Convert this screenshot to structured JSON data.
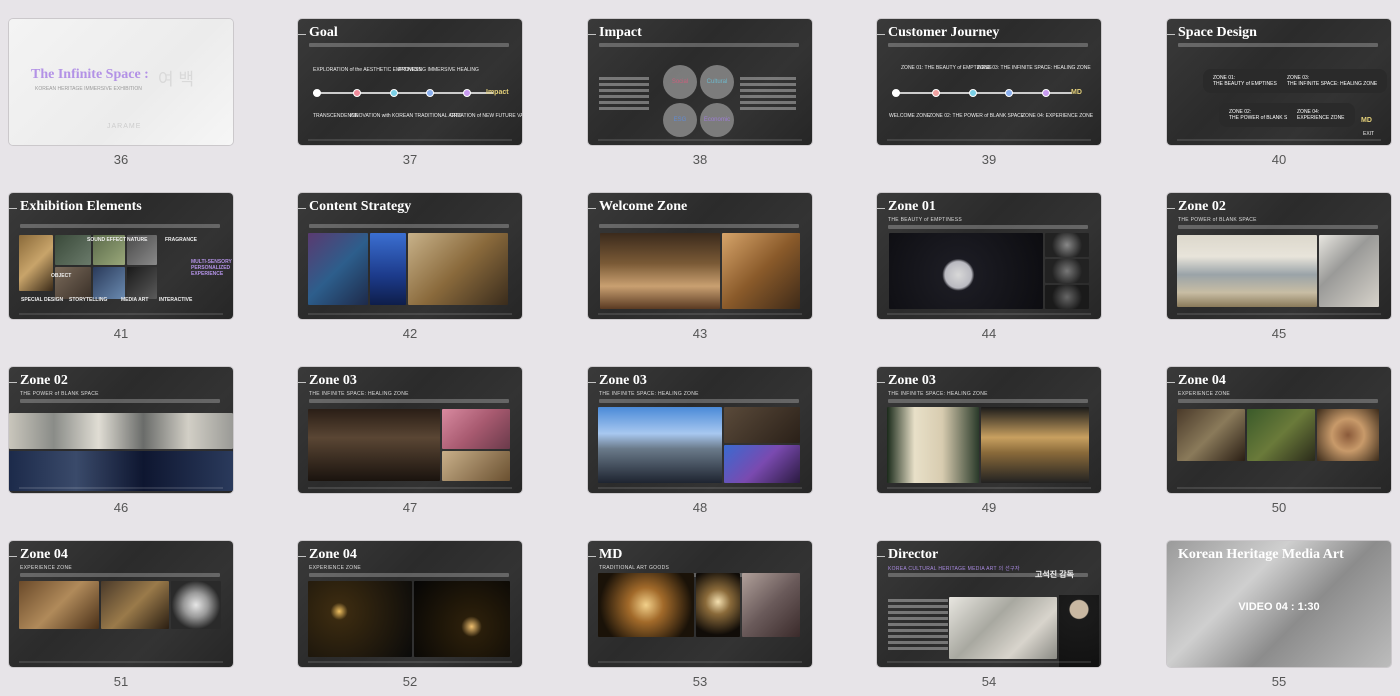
{
  "slides": [
    {
      "number": "36",
      "title": "The Infinite Space : ",
      "korean": "여 백",
      "subtitle": "KOREAN HERITAGE IMMERSIVE EXHIBITION",
      "brand": "JARAME",
      "variant": "cover"
    },
    {
      "number": "37",
      "title": "Goal",
      "variant": "goal",
      "labels": [
        "EXPLORATION of the AESTHETIC EMPTINESS",
        "PROVIDING IMMERSIVE HEALING",
        "TRANSCENDENCE",
        "INNOVATION with KOREAN TRADITIONAL ARTS",
        "CREATION of NEW FUTURE VALUE"
      ],
      "end_label": "Impact"
    },
    {
      "number": "38",
      "title": "Impact",
      "variant": "impact",
      "circles": [
        "Social",
        "Cultural",
        "ESG",
        "Economic"
      ]
    },
    {
      "number": "39",
      "title": "Customer Journey",
      "variant": "journey",
      "labels": [
        "ZONE 01: THE BEAUTY of EMPTINESS",
        "ZONE 03: THE INFINITE SPACE: HEALING ZONE",
        "WELCOME ZONE",
        "ZONE 02: THE POWER of BLANK SPACE",
        "ZONE 04: EXPERIENCE ZONE"
      ],
      "end_label": "MD"
    },
    {
      "number": "40",
      "title": "Space Design",
      "variant": "space",
      "zones": [
        "ZONE 01:\nTHE BEAUTY of EMPTINESS",
        "ZONE 03:\nTHE INFINITE SPACE: HEALING ZONE",
        "ZONE 02:\nTHE POWER of BLANK SPACE",
        "ZONE 04:\nEXPERIENCE ZONE"
      ],
      "end_label": "MD",
      "exit": "EXIT"
    },
    {
      "number": "41",
      "title": "Exhibition Elements",
      "variant": "elements",
      "tags": [
        "SOUND EFFECT",
        "NATURE",
        "FRAGRANCE",
        "OBJECT",
        "SPECIAL DESIGN",
        "STORYTELLING",
        "MEDIA ART",
        "INTERACTIVE"
      ],
      "highlight": "MULTI-SENSORY\nPERSONALIZED\nEXPERIENCE"
    },
    {
      "number": "42",
      "title": "Content Strategy",
      "variant": "photos"
    },
    {
      "number": "43",
      "title": "Welcome Zone",
      "variant": "photos"
    },
    {
      "number": "44",
      "title": "Zone 01",
      "subtitle": "THE BEAUTY of EMPTINESS",
      "variant": "photos"
    },
    {
      "number": "45",
      "title": "Zone 02",
      "subtitle": "THE POWER of BLANK SPACE",
      "variant": "photos"
    },
    {
      "number": "46",
      "title": "Zone 02",
      "subtitle": "THE POWER of BLANK SPACE",
      "variant": "photos"
    },
    {
      "number": "47",
      "title": "Zone 03",
      "subtitle": "THE INFINITE SPACE: HEALING ZONE",
      "variant": "photos"
    },
    {
      "number": "48",
      "title": "Zone 03",
      "subtitle": "THE INFINITE SPACE: HEALING ZONE",
      "variant": "photos"
    },
    {
      "number": "49",
      "title": "Zone 03",
      "subtitle": "THE INFINITE SPACE: HEALING ZONE",
      "variant": "photos"
    },
    {
      "number": "50",
      "title": "Zone 04",
      "subtitle": "EXPERIENCE ZONE",
      "variant": "photos"
    },
    {
      "number": "51",
      "title": "Zone 04",
      "subtitle": "EXPERIENCE ZONE",
      "variant": "photos"
    },
    {
      "number": "52",
      "title": "Zone 04",
      "subtitle": "EXPERIENCE ZONE",
      "variant": "photos"
    },
    {
      "number": "53",
      "title": "MD",
      "subtitle": "TRADITIONAL ART GOODS",
      "variant": "photos"
    },
    {
      "number": "54",
      "title": "Director",
      "subtitle": "KOREA CULTURAL HERITAGE MEDIA ART 의 선구자",
      "name": "고석진 감독",
      "variant": "director"
    },
    {
      "number": "55",
      "title": "Korean Heritage Media Art",
      "caption": "VIDEO 04 : 1:30",
      "variant": "video"
    }
  ]
}
